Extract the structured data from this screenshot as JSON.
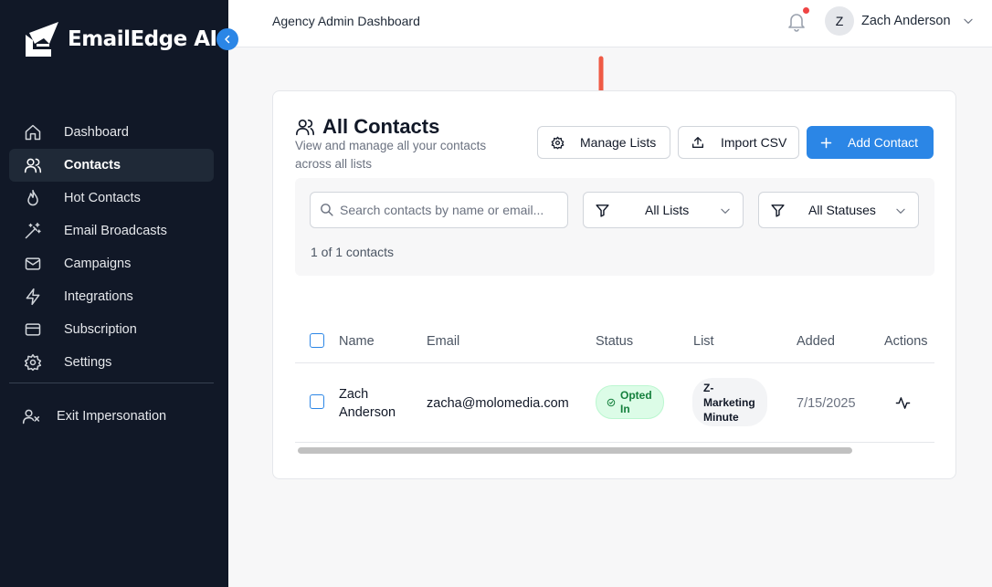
{
  "brand": {
    "name": "EmailEdge AI",
    "accent": "#2b86e6",
    "sidebar_bg": "#111827"
  },
  "sidebar": {
    "items": [
      {
        "label": "Dashboard",
        "icon": "home-icon",
        "active": false
      },
      {
        "label": "Contacts",
        "icon": "users-icon",
        "active": true
      },
      {
        "label": "Hot Contacts",
        "icon": "flame-icon",
        "active": false
      },
      {
        "label": "Email Broadcasts",
        "icon": "magic-wand-icon",
        "active": false
      },
      {
        "label": "Campaigns",
        "icon": "mail-icon",
        "active": false
      },
      {
        "label": "Integrations",
        "icon": "lightning-icon",
        "active": false
      },
      {
        "label": "Subscription",
        "icon": "credit-card-icon",
        "active": false
      },
      {
        "label": "Settings",
        "icon": "gear-icon",
        "active": false
      }
    ],
    "exit_label": "Exit Impersonation"
  },
  "header": {
    "title": "Agency Admin Dashboard",
    "user_initial": "Z",
    "user_name": "Zach Anderson",
    "notification_color": "#ef4444"
  },
  "contacts": {
    "title": "All Contacts",
    "subtitle": "View and manage all your contacts across all lists",
    "manage_lists_label": "Manage Lists",
    "import_csv_label": "Import CSV",
    "add_contact_label": "Add Contact",
    "search_placeholder": "Search contacts by name or email...",
    "list_filter": "All Lists",
    "status_filter": "All Statuses",
    "count_text": "1 of 1 contacts",
    "columns": [
      "Name",
      "Email",
      "Status",
      "List",
      "Added",
      "Actions"
    ],
    "rows": [
      {
        "name": "Zach Anderson",
        "email": "zacha@molomedia.com",
        "status": "Opted In",
        "list": "Z-Marketing Minute",
        "added": "7/15/2025",
        "action_icon": "activity-icon"
      }
    ]
  },
  "annotation": {
    "arrow_color": "#ef5a45",
    "icon": "arrow-down-icon"
  }
}
